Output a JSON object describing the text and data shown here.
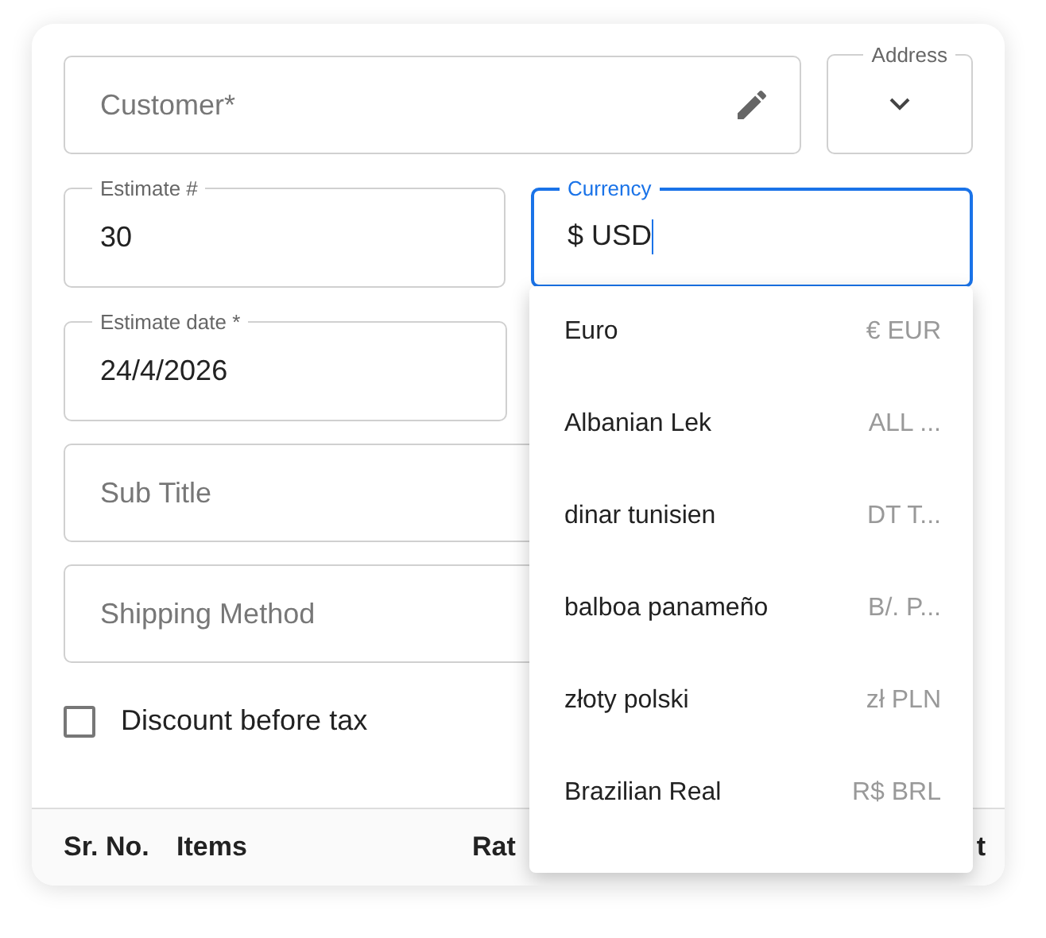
{
  "customer": {
    "placeholder": "Customer*"
  },
  "address": {
    "label": "Address"
  },
  "estimate_number": {
    "label": "Estimate #",
    "value": "30"
  },
  "currency": {
    "label": "Currency",
    "value": "$ USD",
    "focused": true
  },
  "estimate_date": {
    "label": "Estimate date *",
    "value": "24/4/2026"
  },
  "sub_title": {
    "placeholder": "Sub Title"
  },
  "shipping_method": {
    "placeholder": "Shipping Method"
  },
  "discount_before_tax": {
    "label": "Discount before tax",
    "checked": false
  },
  "currency_options": [
    {
      "name": "Euro",
      "code": "€ EUR"
    },
    {
      "name": "Albanian Lek",
      "code": "ALL ..."
    },
    {
      "name": "dinar tunisien",
      "code": "DT T..."
    },
    {
      "name": "balboa panameño",
      "code": "B/. P..."
    },
    {
      "name": "złoty polski",
      "code": "zł PLN"
    },
    {
      "name": "Brazilian Real",
      "code": "R$ BRL"
    }
  ],
  "table": {
    "columns": [
      "Sr. No.",
      "Items",
      "Rat",
      "t"
    ]
  }
}
